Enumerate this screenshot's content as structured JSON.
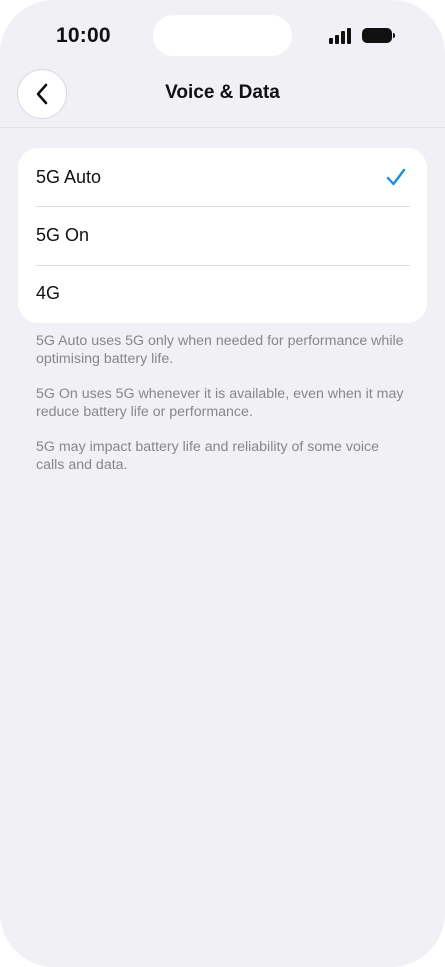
{
  "status_bar": {
    "time": "10:00",
    "icons": [
      "signal-icon",
      "battery-icon"
    ]
  },
  "nav": {
    "back_icon": "chevron-left-icon",
    "title": "Voice & Data"
  },
  "options": [
    {
      "label": "5G Auto",
      "selected": true
    },
    {
      "label": "5G On",
      "selected": false
    },
    {
      "label": "4G",
      "selected": false
    }
  ],
  "footnotes": [
    "5G Auto uses 5G only when needed for performance while optimising battery life.",
    "5G On uses 5G whenever it is available, even when it may reduce battery life or performance.",
    "5G may impact battery life and reliability of some voice calls and data."
  ],
  "colors": {
    "background": "#f1f0f5",
    "card": "#ffffff",
    "accent": "#1a8fe3",
    "text": "#111111",
    "secondary_text": "#87868d"
  }
}
